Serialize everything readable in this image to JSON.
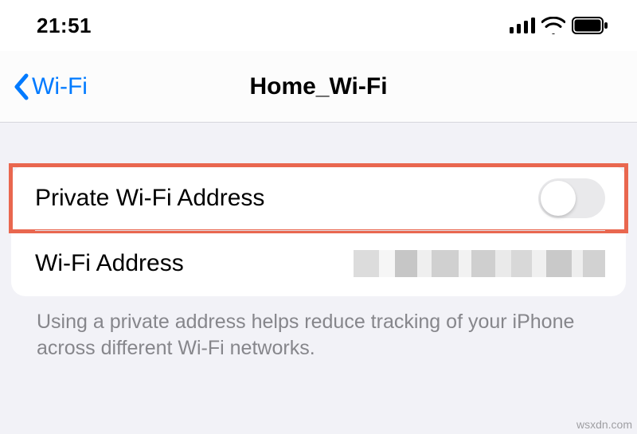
{
  "status_bar": {
    "time": "21:51"
  },
  "nav": {
    "back_label": "Wi-Fi",
    "title": "Home_Wi-Fi"
  },
  "rows": {
    "private_wifi_label": "Private Wi-Fi Address",
    "private_wifi_toggle_on": false,
    "wifi_addr_label": "Wi-Fi Address",
    "wifi_addr_value": ""
  },
  "footer": "Using a private address helps reduce tracking of your iPhone across different Wi-Fi networks.",
  "watermark": "wsxdn.com"
}
